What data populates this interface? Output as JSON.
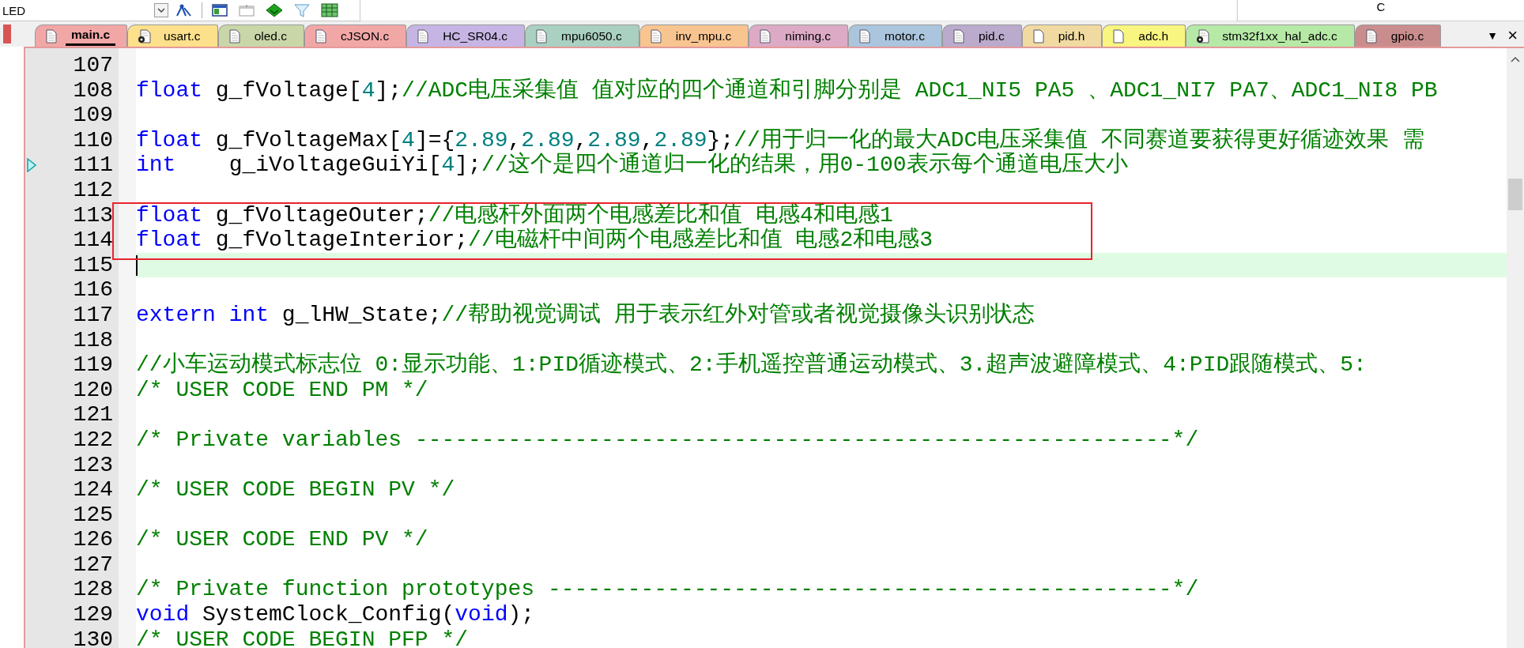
{
  "toolbar": {
    "target_dropdown": "LED",
    "side_panel_text": "C"
  },
  "tabs": [
    {
      "label": "main.c",
      "selected": true,
      "color": "#f2a7a7",
      "kind": "plain"
    },
    {
      "label": "usart.c",
      "selected": false,
      "color": "#fde08c",
      "kind": "gear"
    },
    {
      "label": "oled.c",
      "selected": false,
      "color": "#c9d7a8",
      "kind": "plain"
    },
    {
      "label": "cJSON.c",
      "selected": false,
      "color": "#f2a7a7",
      "kind": "plain"
    },
    {
      "label": "HC_SR04.c",
      "selected": false,
      "color": "#c6b5e4",
      "kind": "plain"
    },
    {
      "label": "mpu6050.c",
      "selected": false,
      "color": "#a9d0c1",
      "kind": "plain"
    },
    {
      "label": "inv_mpu.c",
      "selected": false,
      "color": "#f8c591",
      "kind": "plain"
    },
    {
      "label": "niming.c",
      "selected": false,
      "color": "#dcaac5",
      "kind": "plain"
    },
    {
      "label": "motor.c",
      "selected": false,
      "color": "#aac5dd",
      "kind": "plain"
    },
    {
      "label": "pid.c",
      "selected": false,
      "color": "#baaacc",
      "kind": "plain"
    },
    {
      "label": "pid.h",
      "selected": false,
      "color": "#f1daa1",
      "kind": "header"
    },
    {
      "label": "adc.h",
      "selected": false,
      "color": "#f8f580",
      "kind": "header"
    },
    {
      "label": "stm32f1xx_hal_adc.c",
      "selected": false,
      "color": "#b6e9a6",
      "kind": "gear"
    },
    {
      "label": "gpio.c",
      "selected": false,
      "color": "#ca8d8d",
      "kind": "plain"
    }
  ],
  "tab_menu": {
    "dropdown": "▼",
    "close": "×"
  },
  "lines": [
    {
      "number": "107",
      "current": false,
      "marker": false,
      "boxed": false
    },
    {
      "number": "108",
      "current": false,
      "marker": false,
      "boxed": false,
      "tokens": [
        {
          "kind": "kw",
          "text": "float"
        },
        {
          "kind": "txt",
          "text": " g_fVoltage["
        },
        {
          "kind": "num",
          "text": "4"
        },
        {
          "kind": "txt",
          "text": "];"
        },
        {
          "kind": "cmt",
          "text": "//ADC电压采集值 值对应的四个通道和引脚分别是 ADC1_NI5 PA5 、ADC1_NI7 PA7、ADC1_NI8 PB"
        }
      ]
    },
    {
      "number": "109",
      "current": false,
      "marker": false,
      "boxed": false
    },
    {
      "number": "110",
      "current": false,
      "marker": false,
      "boxed": false,
      "tokens": [
        {
          "kind": "kw",
          "text": "float"
        },
        {
          "kind": "txt",
          "text": " g_fVoltageMax["
        },
        {
          "kind": "num",
          "text": "4"
        },
        {
          "kind": "txt",
          "text": "]={"
        },
        {
          "kind": "num",
          "text": "2.89"
        },
        {
          "kind": "txt",
          "text": ","
        },
        {
          "kind": "num",
          "text": "2.89"
        },
        {
          "kind": "txt",
          "text": ","
        },
        {
          "kind": "num",
          "text": "2.89"
        },
        {
          "kind": "txt",
          "text": ","
        },
        {
          "kind": "num",
          "text": "2.89"
        },
        {
          "kind": "txt",
          "text": "};"
        },
        {
          "kind": "cmt",
          "text": "//用于归一化的最大ADC电压采集值 不同赛道要获得更好循迹效果 需"
        }
      ]
    },
    {
      "number": "111",
      "current": false,
      "marker": true,
      "boxed": false,
      "tokens": [
        {
          "kind": "kw",
          "text": "int"
        },
        {
          "kind": "txt",
          "text": "    g_iVoltageGuiYi["
        },
        {
          "kind": "num",
          "text": "4"
        },
        {
          "kind": "txt",
          "text": "];"
        },
        {
          "kind": "cmt",
          "text": "//这个是四个通道归一化的结果，用0-100表示每个通道电压大小"
        }
      ]
    },
    {
      "number": "112",
      "current": false,
      "marker": false,
      "boxed": false
    },
    {
      "number": "113",
      "current": false,
      "marker": false,
      "boxed": true,
      "tokens": [
        {
          "kind": "kw",
          "text": "float"
        },
        {
          "kind": "txt",
          "text": " g_fVoltageOuter;"
        },
        {
          "kind": "cmt",
          "text": "//电感杆外面两个电感差比和值 电感4和电感1"
        }
      ]
    },
    {
      "number": "114",
      "current": false,
      "marker": false,
      "boxed": true,
      "tokens": [
        {
          "kind": "kw",
          "text": "float"
        },
        {
          "kind": "txt",
          "text": " g_fVoltageInterior;"
        },
        {
          "kind": "cmt",
          "text": "//电磁杆中间两个电感差比和值 电感2和电感3"
        }
      ]
    },
    {
      "number": "115",
      "current": true,
      "marker": false,
      "boxed": false
    },
    {
      "number": "116",
      "current": false,
      "marker": false,
      "boxed": false
    },
    {
      "number": "117",
      "current": false,
      "marker": false,
      "boxed": false,
      "tokens": [
        {
          "kind": "kw",
          "text": "extern"
        },
        {
          "kind": "kw",
          "text": " int"
        },
        {
          "kind": "txt",
          "text": " g_lHW_State;"
        },
        {
          "kind": "cmt",
          "text": "//帮助视觉调试 用于表示红外对管或者视觉摄像头识别状态"
        }
      ]
    },
    {
      "number": "118",
      "current": false,
      "marker": false,
      "boxed": false
    },
    {
      "number": "119",
      "current": false,
      "marker": false,
      "boxed": false,
      "tokens": [
        {
          "kind": "cmt",
          "text": "//小车运动模式标志位 0:显示功能、1:PID循迹模式、2:手机遥控普通运动模式、3.超声波避障模式、4:PID跟随模式、5:"
        }
      ]
    },
    {
      "number": "120",
      "current": false,
      "marker": false,
      "boxed": false,
      "tokens": [
        {
          "kind": "cmt",
          "text": "/* USER CODE END PM */"
        }
      ]
    },
    {
      "number": "121",
      "current": false,
      "marker": false,
      "boxed": false
    },
    {
      "number": "122",
      "current": false,
      "marker": false,
      "boxed": false,
      "tokens": [
        {
          "kind": "cmt",
          "text": "/* Private variables ---------------------------------------------------------*/"
        }
      ]
    },
    {
      "number": "123",
      "current": false,
      "marker": false,
      "boxed": false
    },
    {
      "number": "124",
      "current": false,
      "marker": false,
      "boxed": false,
      "tokens": [
        {
          "kind": "cmt",
          "text": "/* USER CODE BEGIN PV */"
        }
      ]
    },
    {
      "number": "125",
      "current": false,
      "marker": false,
      "boxed": false
    },
    {
      "number": "126",
      "current": false,
      "marker": false,
      "boxed": false,
      "tokens": [
        {
          "kind": "cmt",
          "text": "/* USER CODE END PV */"
        }
      ]
    },
    {
      "number": "127",
      "current": false,
      "marker": false,
      "boxed": false
    },
    {
      "number": "128",
      "current": false,
      "marker": false,
      "boxed": false,
      "tokens": [
        {
          "kind": "cmt",
          "text": "/* Private function prototypes -----------------------------------------------*/"
        }
      ]
    },
    {
      "number": "129",
      "current": false,
      "marker": false,
      "boxed": false,
      "tokens": [
        {
          "kind": "kw",
          "text": "void"
        },
        {
          "kind": "txt",
          "text": " SystemClock_Config("
        },
        {
          "kind": "kw",
          "text": "void"
        },
        {
          "kind": "txt",
          "text": ");"
        }
      ]
    },
    {
      "number": "130",
      "current": false,
      "marker": false,
      "boxed": false,
      "tokens": [
        {
          "kind": "cmt",
          "text": "/* USER CODE BEGIN PFP */"
        }
      ]
    }
  ]
}
